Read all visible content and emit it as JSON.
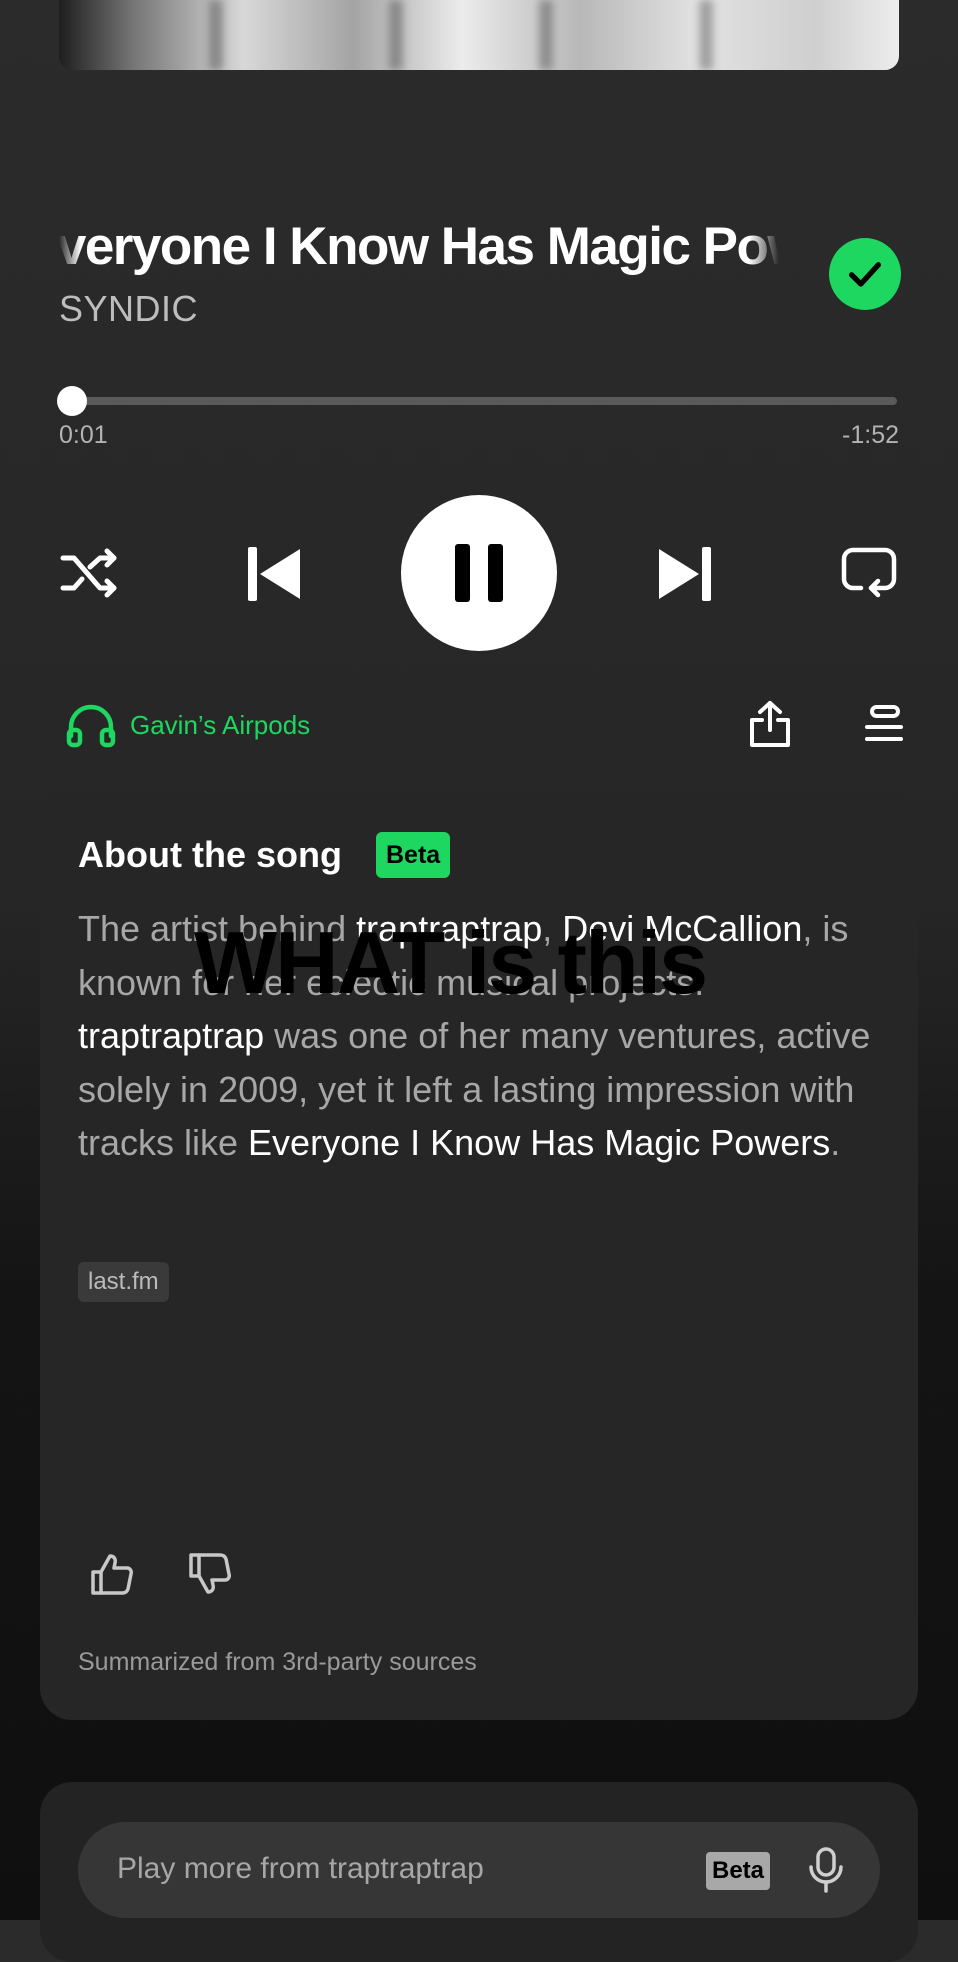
{
  "now_playing": {
    "title": "Everyone I Know Has Magic Powers",
    "artist": "SYNDIC",
    "saved": true,
    "accent_color": "#1ed760"
  },
  "progress": {
    "elapsed": "0:01",
    "remaining": "-1:52",
    "fraction": 0.01
  },
  "controls": {
    "shuffle_icon": "shuffle-icon",
    "previous_icon": "skip-back-icon",
    "play_pause_icon": "pause-icon",
    "next_icon": "skip-forward-icon",
    "repeat_icon": "repeat-icon"
  },
  "device": {
    "icon": "headphones-icon",
    "label": "Gavin’s Airpods"
  },
  "actions": {
    "share_icon": "share-icon",
    "queue_icon": "queue-icon"
  },
  "about": {
    "title": "About the song",
    "badge": "Beta",
    "description": {
      "p1": "The artist behind ",
      "h1": "traptraptrap",
      "p2": ", ",
      "h2": "Devi McCallion",
      "p3": ", is known for her eclectic musical projects. ",
      "h3": "traptraptrap",
      "p4": " was one of her many ventures, active solely in 2009, yet it left a lasting impression with tracks like ",
      "h4": "Everyone I Know Has Magic Powers",
      "p5": "."
    },
    "source_chip": "last.fm",
    "feedback_icons": [
      "thumbs-up-icon",
      "thumbs-down-icon"
    ],
    "footer": "Summarized from 3rd-party sources"
  },
  "overlay_text": "WHAT is this",
  "prompt": {
    "placeholder": "Play more from traptraptrap",
    "badge": "Beta",
    "mic_icon": "microphone-icon"
  }
}
